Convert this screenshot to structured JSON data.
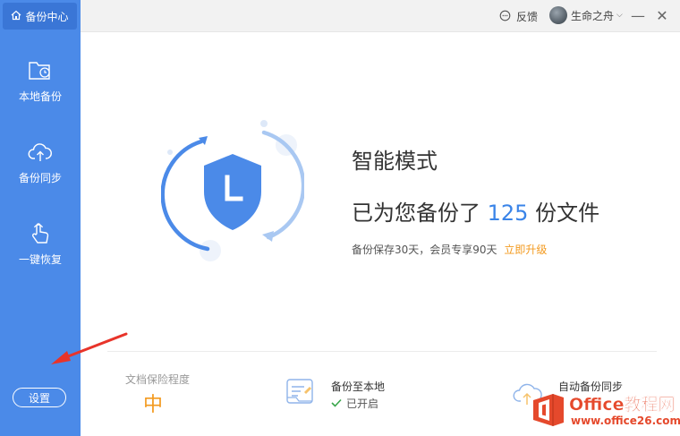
{
  "app": {
    "brand_label": "备份中心"
  },
  "sidebar": {
    "items": [
      {
        "label": "本地备份",
        "icon": "folder-clock-icon"
      },
      {
        "label": "备份同步",
        "icon": "cloud-upload-icon"
      },
      {
        "label": "一键恢复",
        "icon": "hand-touch-icon"
      }
    ],
    "settings_label": "设置"
  },
  "titlebar": {
    "feedback_label": "反馈",
    "user_name": "生命之舟",
    "minimize": "—",
    "close": "✕"
  },
  "main": {
    "mode_title": "智能模式",
    "backup_prefix": "已为您备份了",
    "backup_count": "125",
    "backup_suffix": "份文件",
    "retention_text": "备份保存30天，会员专享90天",
    "upgrade_label": "立即升级"
  },
  "bottom": {
    "level_label": "文档保险程度",
    "level_value": "中",
    "local_title": "备份至本地",
    "local_status": "已开启",
    "sync_title": "自动备份同步"
  },
  "watermark": {
    "name": "Office教程网",
    "url": "www.office26.com"
  },
  "colors": {
    "sidebar": "#4b8ae8",
    "accent": "#3a84e8",
    "orange": "#f39a1f",
    "check": "#3aa64b"
  }
}
